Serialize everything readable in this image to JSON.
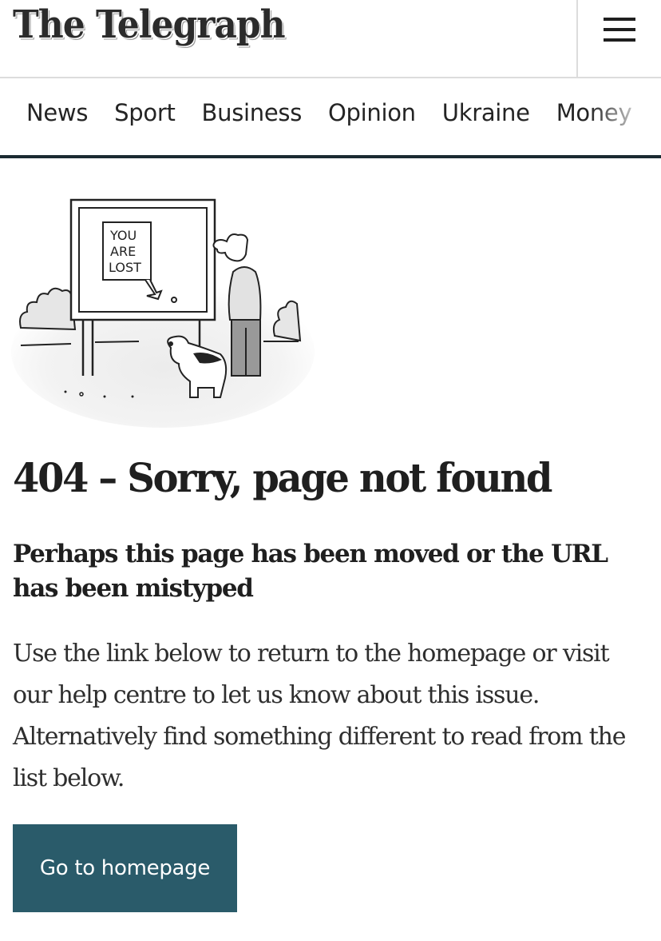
{
  "header": {
    "logo_text": "The Telegraph",
    "menu_icon": "hamburger-menu-icon"
  },
  "nav": {
    "items": [
      "News",
      "Sport",
      "Business",
      "Opinion",
      "Ukraine",
      "Money"
    ]
  },
  "illustration": {
    "sign_text": [
      "YOU",
      "ARE",
      "LOST"
    ],
    "description": "Cartoon of a man and dog looking at a map sign reading YOU ARE LOST"
  },
  "content": {
    "title": "404 – Sorry, page not found",
    "subtitle": "Perhaps this page has been moved or the URL has been mistyped",
    "body": "Use the link below to return to the homepage or visit our help centre to let us know about this issue. Alternatively find something different to read from the list below.",
    "button_label": "Go to homepage"
  },
  "colors": {
    "button_bg": "#2a5b6a",
    "nav_rule": "#1b2a31",
    "header_border": "#dcdcdc",
    "text": "#1f1f1f"
  }
}
